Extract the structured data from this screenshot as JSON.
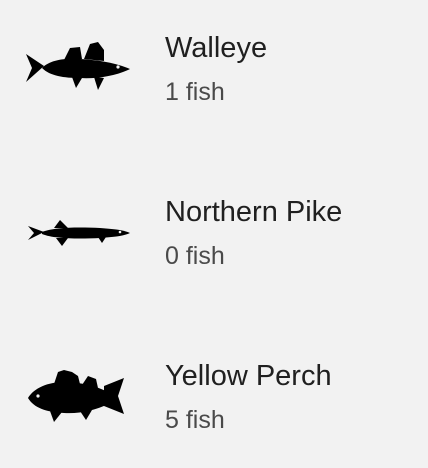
{
  "fish_list": [
    {
      "icon": "walleye-icon",
      "name": "Walleye",
      "count_text": "1 fish"
    },
    {
      "icon": "northern-pike-icon",
      "name": "Northern Pike",
      "count_text": "0 fish"
    },
    {
      "icon": "yellow-perch-icon",
      "name": "Yellow Perch",
      "count_text": "5 fish"
    }
  ],
  "colors": {
    "background": "#f2f2f2",
    "icon": "#000000",
    "title_text": "#202020",
    "subtitle_text": "#4a4a4a"
  }
}
